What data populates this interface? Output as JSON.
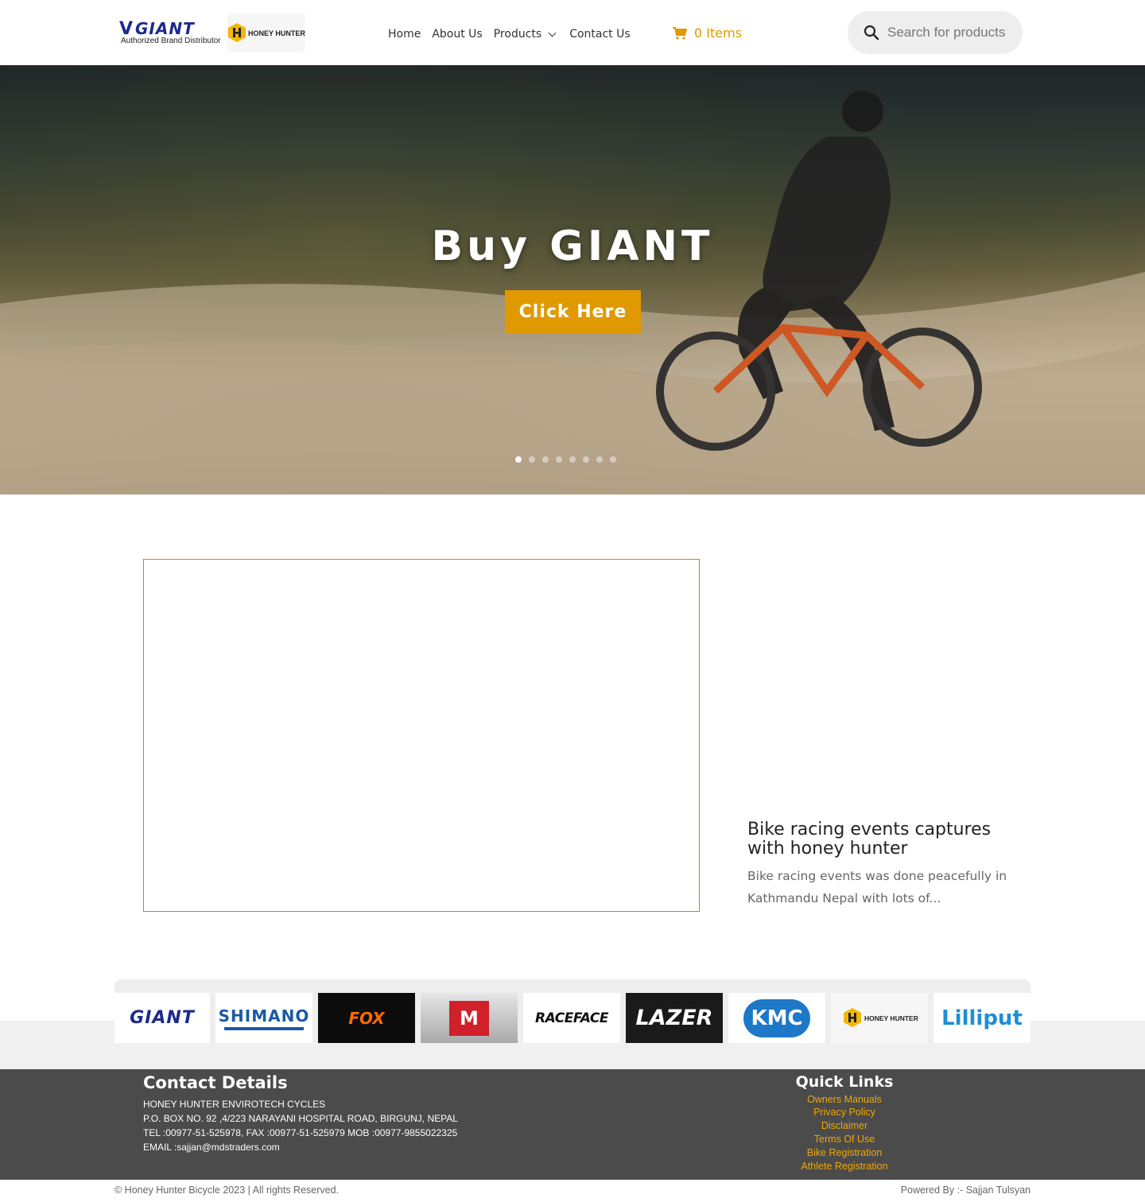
{
  "header": {
    "logo_giant_text": "GIANT",
    "logo_giant_sub": "Authorized Brand Distributor",
    "logo_honey_text": "HONEY HUNTER",
    "nav": [
      {
        "label": "Home"
      },
      {
        "label": "About Us"
      },
      {
        "label": "Products"
      },
      {
        "label": "Contact Us"
      }
    ],
    "cart_label": "0 Items",
    "search_placeholder": "Search for products"
  },
  "hero": {
    "title": "Buy GIANT",
    "button_label": "Click Here",
    "slide_count": 8,
    "active_slide": 1
  },
  "post": {
    "title": "Bike racing events captures with honey hunter",
    "excerpt": "Bike racing events was done peacefully in Kathmandu Nepal with lots of..."
  },
  "brands": {
    "giant": "GIANT",
    "shimano": "SHIMANO",
    "fox": "FOX",
    "marzocchi": "M",
    "raceface": "RACEFACE",
    "lazer": "LAZER",
    "kmc": "KMC",
    "honey_hunter": "HONEY HUNTER",
    "lilliput": "Lilliput"
  },
  "footer": {
    "contact_heading": "Contact Details",
    "contact_lines": [
      "HONEY HUNTER ENVIROTECH CYCLES",
      "P.O. BOX NO. 92 ,4/223 NARAYANI HOSPITAL ROAD, BIRGUNJ, NEPAL",
      "TEL :00977-51-525978, FAX :00977-51-525979 MOB :00977-9855022325",
      "EMAIL :sajjan@mdstraders.com"
    ],
    "quick_links_heading": "Quick Links",
    "quick_links": [
      "Owners Manuals",
      "Privacy Policy",
      "Disclaimer",
      "Terms Of Use",
      "Bike Registration",
      "Athlete Registration"
    ],
    "copyright": "© Honey Hunter Bicycle 2023 | All rights Reserved.",
    "powered_by": "Powered By :- Sajjan Tulsyan"
  },
  "colors": {
    "accent": "#e09900",
    "giant_blue": "#1d2a8c",
    "footer_bg": "#4b4b4b"
  },
  "icons": [
    "search-icon",
    "cart-icon",
    "chevron-down-icon"
  ]
}
